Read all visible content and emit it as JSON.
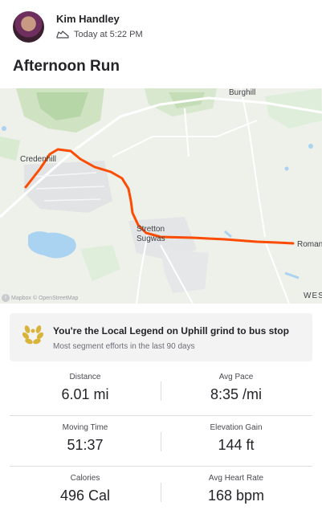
{
  "activity": {
    "athlete_name": "Kim Handley",
    "timestamp": "Today at 5:22 PM",
    "activity_type_icon": "shoe-icon",
    "title": "Afternoon Run"
  },
  "map": {
    "labels": {
      "burghill": "Burghill",
      "credenhill": "Credenhill",
      "stretton": "Stretton",
      "sugwas": "Sugwas",
      "roman": "Roman",
      "wes": "WES"
    },
    "attribution": "Mapbox © OpenStreetMap",
    "route_color": "#fc4c02"
  },
  "local_legend": {
    "icon": "laurel-icon",
    "title": "You're the Local Legend on Uphill grind to bus stop",
    "subtitle": "Most segment efforts in the last 90 days"
  },
  "stats": [
    {
      "left": {
        "label": "Distance",
        "value": "6.01 mi"
      },
      "right": {
        "label": "Avg Pace",
        "value": "8:35 /mi"
      }
    },
    {
      "left": {
        "label": "Moving Time",
        "value": "51:37"
      },
      "right": {
        "label": "Elevation Gain",
        "value": "144 ft"
      }
    },
    {
      "left": {
        "label": "Calories",
        "value": "496 Cal"
      },
      "right": {
        "label": "Avg Heart Rate",
        "value": "168 bpm"
      }
    }
  ]
}
